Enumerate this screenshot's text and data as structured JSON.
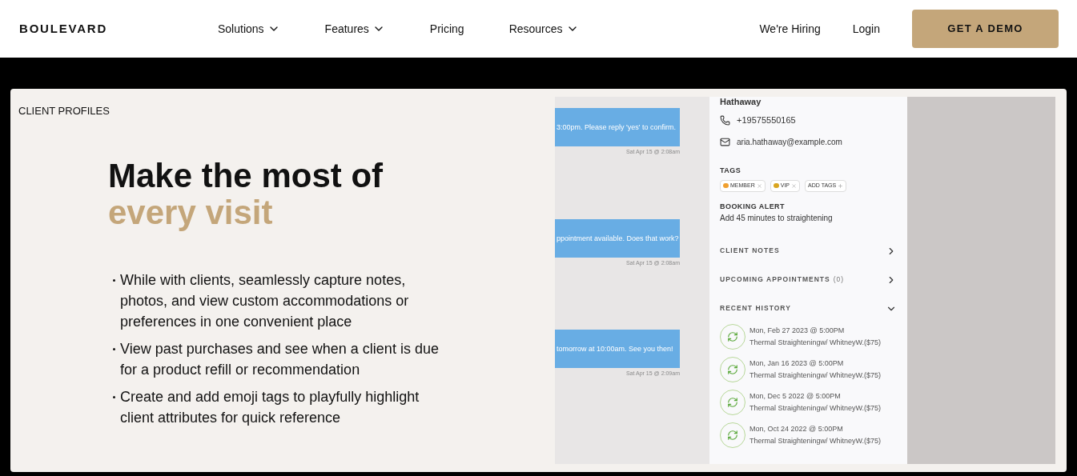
{
  "nav": {
    "logo": "BOULEVARD",
    "links": [
      {
        "label": "Solutions",
        "dropdown": true
      },
      {
        "label": "Features",
        "dropdown": true
      },
      {
        "label": "Pricing",
        "dropdown": false
      },
      {
        "label": "Resources",
        "dropdown": true
      }
    ],
    "right_links": [
      "We're Hiring",
      "Login"
    ],
    "cta": "GET A DEMO"
  },
  "section": {
    "eyebrow": "CLIENT PROFILES",
    "heading": "Make the most of",
    "heading_accent": "every visit",
    "bullets": [
      "While with clients, seamlessly capture notes, photos, and view custom accommodations or preferences in one convenient place",
      "View past purchases and see when a client is due for a product refill or recommendation",
      "Create and add emoji tags to playfully highlight client attributes for quick reference"
    ]
  },
  "app": {
    "messages": [
      {
        "text": "3:00pm. Please reply 'yes' to confirm.",
        "time": "Sat Apr 15 @ 2:08am"
      },
      {
        "text": "ppointment available. Does that work?",
        "time": "Sat Apr 15 @ 2:08am"
      },
      {
        "text": "tomorrow at 10:00am. See you then!",
        "time": "Sat Apr 15 @ 2:09am"
      }
    ],
    "client_name": "Hathaway",
    "phone": "+19575550165",
    "email": "aria.hathaway@example.com",
    "tags_label": "TAGS",
    "tags": [
      {
        "label": "MEMBER",
        "kind": "emoji",
        "color": "#f0a030"
      },
      {
        "label": "VIP",
        "kind": "emoji",
        "color": "#d9a520"
      },
      {
        "label": "ADD TAGS",
        "kind": "add"
      }
    ],
    "alert_label": "BOOKING ALERT",
    "alert_text": "Add 45 minutes to straightening",
    "sections": [
      {
        "label": "CLIENT NOTES",
        "expanded": false
      },
      {
        "label": "UPCOMING APPOINTMENTS",
        "count": "(0)",
        "expanded": false
      },
      {
        "label": "RECENT HISTORY",
        "expanded": true
      }
    ],
    "history": [
      {
        "date": "Mon, Feb 27 2023 @ 5:00PM",
        "service": "Thermal Straighteningw/ WhitneyW.($75)"
      },
      {
        "date": "Mon, Jan 16 2023 @ 5:00PM",
        "service": "Thermal Straighteningw/ WhitneyW.($75)"
      },
      {
        "date": "Mon, Dec 5 2022 @ 5:00PM",
        "service": "Thermal Straighteningw/ WhitneyW.($75)"
      },
      {
        "date": "Mon, Oct 24 2022 @ 5:00PM",
        "service": "Thermal Straighteningw/ WhitneyW.($75)"
      }
    ]
  }
}
